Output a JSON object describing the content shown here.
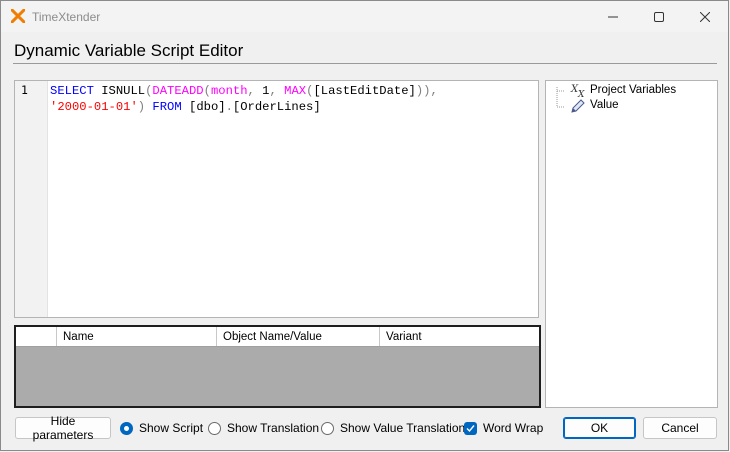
{
  "window": {
    "title": "TimeXtender",
    "logo_icon": "timextender-x-logo",
    "accent_color": "#f07d00"
  },
  "heading": "Dynamic Variable Script Editor",
  "editor": {
    "line_numbers": [
      "1"
    ],
    "code_line1": {
      "t1": "SELECT",
      "t2": " ISNULL",
      "t3": "(",
      "t4": "DATEADD",
      "t5": "(",
      "t6": "month",
      "t7": ",",
      "t8": " 1",
      "t9": ",",
      "t10": " ",
      "t11": "MAX",
      "t12": "(",
      "t13": "[LastEditDate]",
      "t14": "))",
      "t15": ","
    },
    "code_line2": {
      "t1": "'2000-01-01'",
      "t2": ")",
      "t3": " ",
      "t4": "FROM",
      "t5": " [dbo]",
      "t6": ".",
      "t7": "[OrderLines]"
    }
  },
  "parameters_grid": {
    "columns": [
      "",
      "Name",
      "Object Name/Value",
      "Variant"
    ],
    "rows": []
  },
  "tree": {
    "items": [
      {
        "label": "Project Variables",
        "icon": "variable-x-icon"
      },
      {
        "label": "Value",
        "icon": "pencil-icon"
      }
    ]
  },
  "footer": {
    "hide_parameters_label": "Hide parameters",
    "show_script_label": "Show Script",
    "show_script_selected": true,
    "show_translation_label": "Show Translation",
    "show_value_translation_label": "Show Value Translation",
    "word_wrap_label": "Word Wrap",
    "word_wrap_checked": true,
    "ok_label": "OK",
    "cancel_label": "Cancel"
  }
}
